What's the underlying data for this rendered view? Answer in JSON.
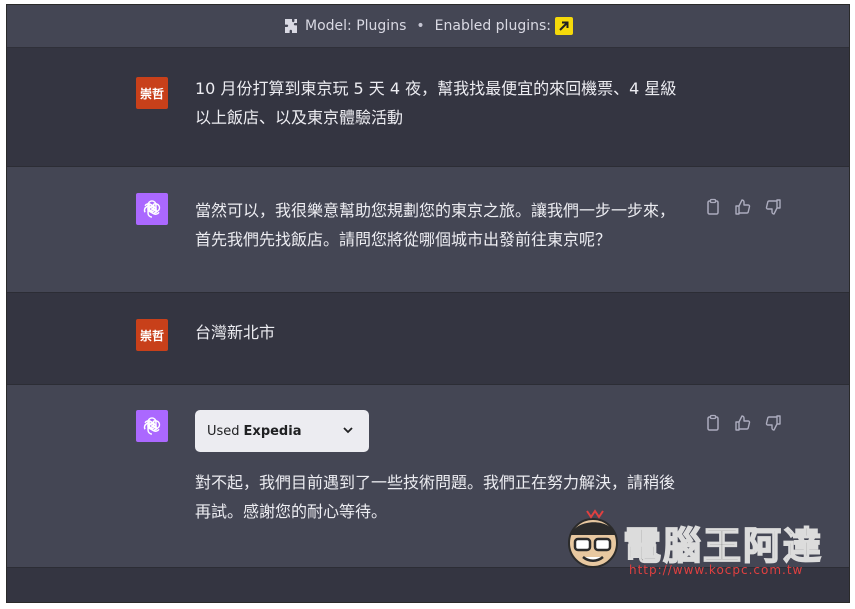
{
  "header": {
    "model_label": "Model: Plugins",
    "separator": "•",
    "plugins_label": "Enabled plugins:",
    "plugin_badge_icon": "arrow-up-right-icon",
    "plugin_badge_color": "#f5d90a"
  },
  "user": {
    "avatar_text": "崇哲",
    "avatar_color": "#c8401a"
  },
  "assistant": {
    "avatar_color": "#ab68ff",
    "avatar_icon": "openai-logo-icon"
  },
  "messages": [
    {
      "role": "user",
      "text": "10 月份打算到東京玩 5 天 4 夜，幫我找最便宜的來回機票、4 星級以上飯店、以及東京體驗活動"
    },
    {
      "role": "assistant",
      "text": "當然可以，我很樂意幫助您規劃您的東京之旅。讓我們一步一步來，首先我們先找飯店。請問您將從哪個城市出發前往東京呢？"
    },
    {
      "role": "user",
      "text": "台灣新北市"
    },
    {
      "role": "assistant",
      "used_prefix": "Used",
      "used_plugin": "Expedia",
      "text": "對不起，我們目前遇到了一些技術問題。我們正在努力解決，請稍後再試。感謝您的耐心等待。"
    }
  ],
  "action_icons": [
    "clipboard-icon",
    "thumbs-up-icon",
    "thumbs-down-icon"
  ],
  "watermark": {
    "text": "電腦王阿達",
    "url": "http://www.kocpc.com.tw"
  }
}
